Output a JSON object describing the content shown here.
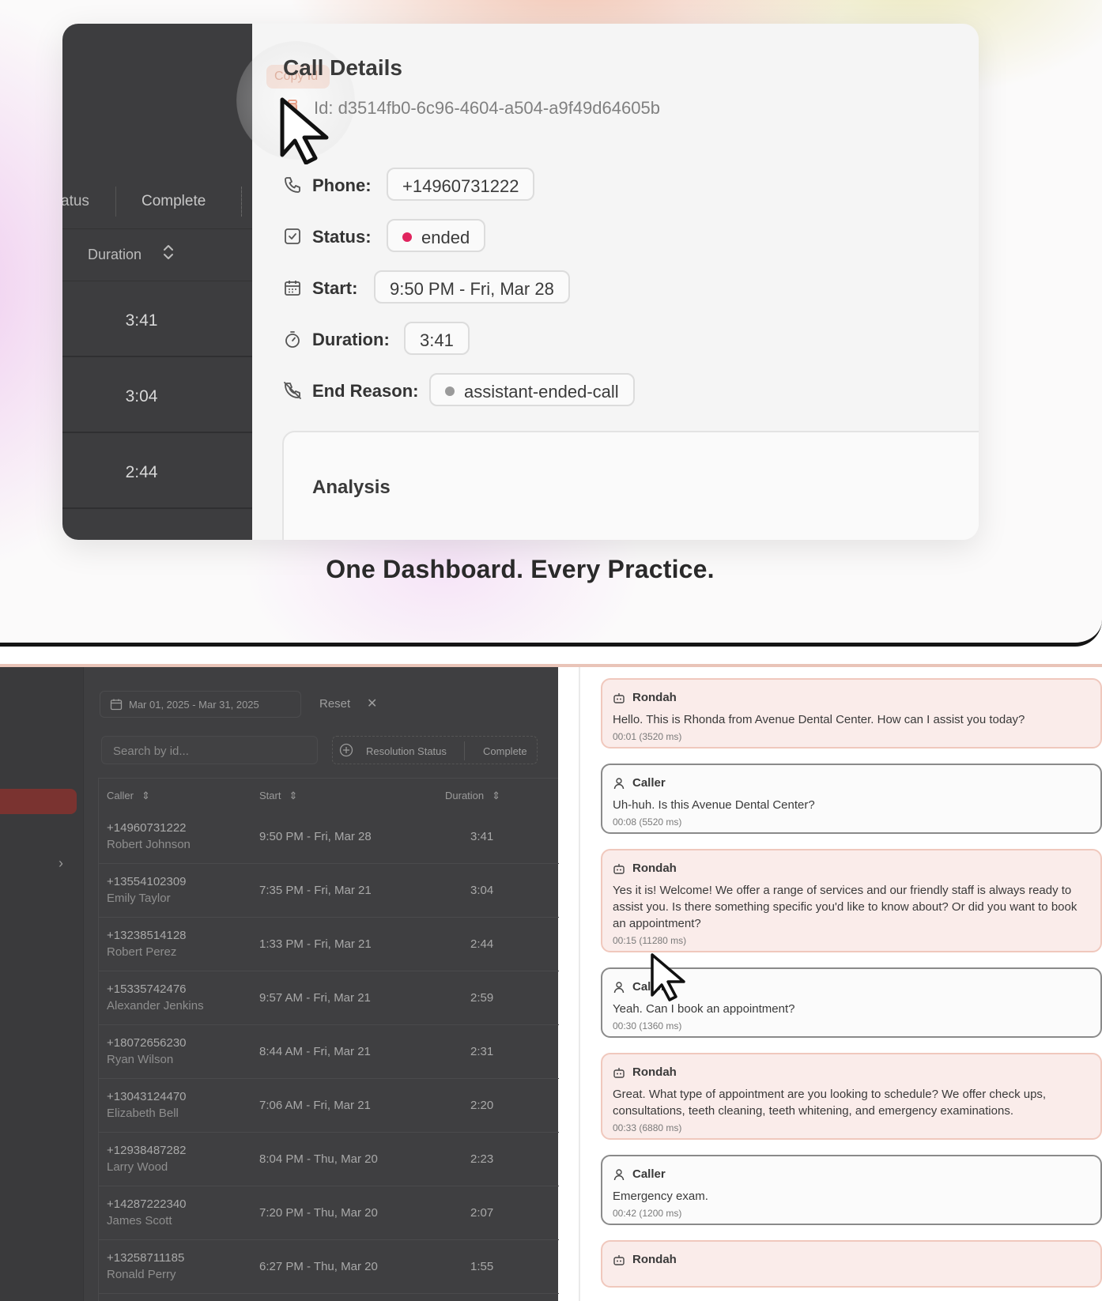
{
  "top": {
    "call_details_title": "Call Details",
    "copy_ghost": "Copy Id",
    "id_text": "Id: d3514fb0-6c96-4604-a504-a9f49d64605b",
    "left_panel": {
      "tab_status": "atus",
      "tab_complete": "Complete",
      "duration_header": "Duration",
      "durations": [
        "3:41",
        "3:04",
        "2:44"
      ]
    },
    "details": [
      {
        "label": "Phone:",
        "value": "+14960731222",
        "icon": "phone-icon"
      },
      {
        "label": "Status:",
        "value": "ended",
        "icon": "checkbox-icon",
        "dot_color": "#e0245e"
      },
      {
        "label": "Start:",
        "value": "9:50 PM - Fri, Mar 28",
        "icon": "calendar-icon"
      },
      {
        "label": "Duration:",
        "value": "3:41",
        "icon": "timer-icon"
      },
      {
        "label": "End Reason:",
        "value": "assistant-ended-call",
        "icon": "phone-off-icon",
        "dot_color": "#9a9a9a"
      }
    ],
    "analysis_title": "Analysis",
    "tagline": "One Dashboard. Every Practice."
  },
  "bottom": {
    "date_range": "Mar 01, 2025 - Mar 31, 2025",
    "reset": "Reset",
    "search_placeholder": "Search by id...",
    "filter_resolution": "Resolution Status",
    "filter_complete": "Complete",
    "columns": {
      "caller": "Caller",
      "start": "Start",
      "duration": "Duration"
    },
    "rows": [
      {
        "phone": "+14960731222",
        "name": "Robert Johnson",
        "start": "9:50 PM - Fri, Mar 28",
        "duration": "3:41"
      },
      {
        "phone": "+13554102309",
        "name": "Emily Taylor",
        "start": "7:35 PM - Fri, Mar 21",
        "duration": "3:04"
      },
      {
        "phone": "+13238514128",
        "name": "Robert Perez",
        "start": "1:33 PM - Fri, Mar 21",
        "duration": "2:44"
      },
      {
        "phone": "+15335742476",
        "name": "Alexander Jenkins",
        "start": "9:57 AM - Fri, Mar 21",
        "duration": "2:59"
      },
      {
        "phone": "+18072656230",
        "name": "Ryan Wilson",
        "start": "8:44 AM - Fri, Mar 21",
        "duration": "2:31"
      },
      {
        "phone": "+13043124470",
        "name": "Elizabeth Bell",
        "start": "7:06 AM - Fri, Mar 21",
        "duration": "2:20"
      },
      {
        "phone": "+12938487282",
        "name": "Larry Wood",
        "start": "8:04 PM - Thu, Mar 20",
        "duration": "2:23"
      },
      {
        "phone": "+14287222340",
        "name": "James Scott",
        "start": "7:20 PM - Thu, Mar 20",
        "duration": "2:07"
      },
      {
        "phone": "+13258711185",
        "name": "Ronald Perry",
        "start": "6:27 PM - Thu, Mar 20",
        "duration": "1:55"
      }
    ],
    "transcript": [
      {
        "role": "bot",
        "speaker": "Rondah",
        "text": "Hello. This is Rhonda from Avenue Dental Center. How can I assist you today?",
        "time": "00:01 (3520 ms)"
      },
      {
        "role": "user",
        "speaker": "Caller",
        "text": "Uh-huh. Is this Avenue Dental Center?",
        "time": "00:08 (5520 ms)"
      },
      {
        "role": "bot",
        "speaker": "Rondah",
        "text": "Yes it is! Welcome! We offer a range of services and our friendly staff is always ready to assist you. Is there something specific you'd like to know about? Or did you want to book an appointment?",
        "time": "00:15 (11280 ms)"
      },
      {
        "role": "user",
        "speaker": "Caller",
        "text": "Yeah. Can I book an appointment?",
        "time": "00:30 (1360 ms)"
      },
      {
        "role": "bot",
        "speaker": "Rondah",
        "text": "Great. What type of appointment are you looking to schedule? We offer check ups, consultations, teeth cleaning, teeth whitening, and emergency examinations.",
        "time": "00:33 (6880 ms)"
      },
      {
        "role": "user",
        "speaker": "Caller",
        "text": "Emergency exam.",
        "time": "00:42 (1200 ms)"
      },
      {
        "role": "bot",
        "speaker": "Rondah",
        "text": "",
        "time": ""
      }
    ]
  }
}
